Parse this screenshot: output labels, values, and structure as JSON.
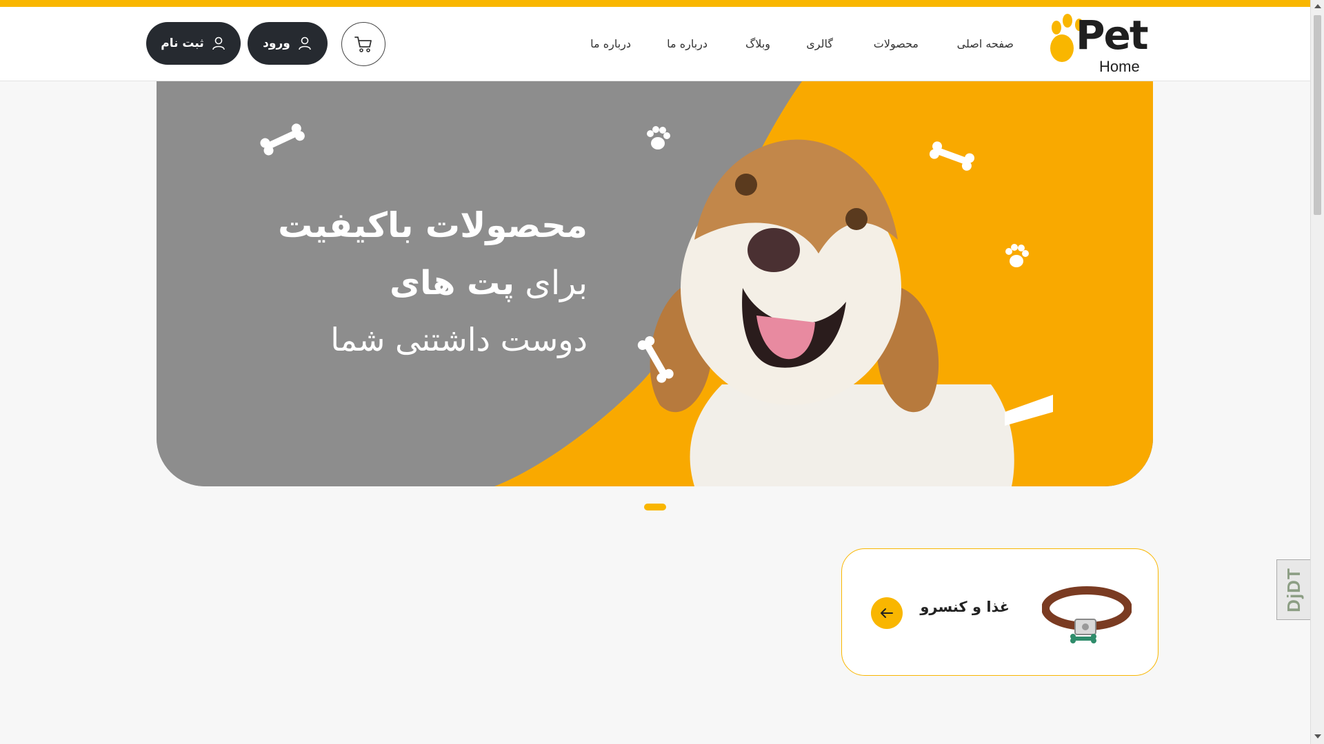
{
  "brand": {
    "logo_main": "Pet",
    "logo_sub": "Home",
    "accent_color": "#f9b600",
    "dark_color": "#262a30",
    "hero_gray": "#8d8d8d"
  },
  "nav": {
    "items": [
      {
        "label": "صفحه اصلی"
      },
      {
        "label": "محصولات"
      },
      {
        "label": "گالری"
      },
      {
        "label": "وبلاگ"
      },
      {
        "label": "درباره ما"
      },
      {
        "label": "درباره ما"
      }
    ]
  },
  "header_actions": {
    "cart_icon": "cart-icon",
    "login_label": "ورود",
    "register_label": "ثبت نام",
    "user_icon": "user-icon"
  },
  "hero": {
    "line1": "محصولات باکیفیت",
    "line2_prefix": "برای",
    "line2_bold": "پت های",
    "line3": "دوست داشتنی شما"
  },
  "slider": {
    "dot_count": 1,
    "active_index": 0
  },
  "category_card": {
    "title": "غذا و کنسرو",
    "image": "dog-collar-image",
    "arrow_icon": "arrow-left-icon"
  },
  "debug_toolbar": {
    "label": "DjDT"
  }
}
